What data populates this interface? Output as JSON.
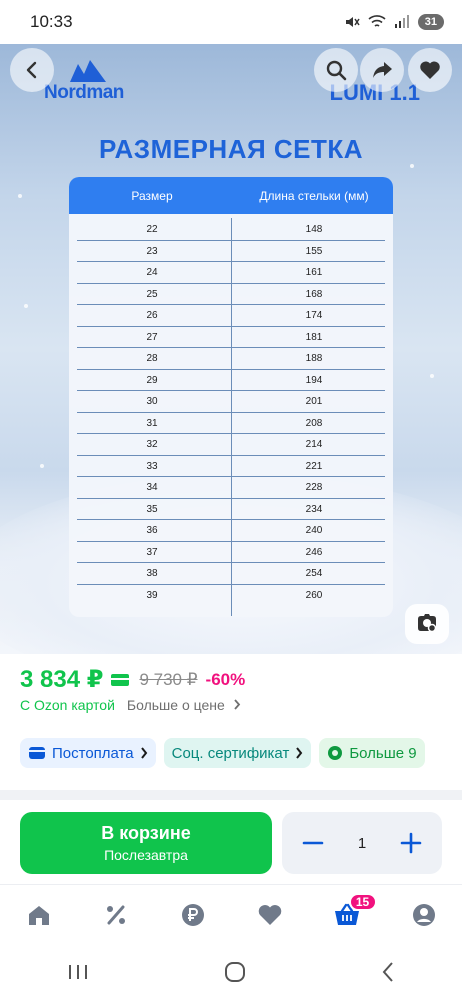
{
  "status_bar": {
    "time": "10:33",
    "battery": "31"
  },
  "product_image": {
    "brand": "Nordman",
    "model": "LUMI 1.1",
    "chart_title": "РАЗМЕРНАЯ СЕТКА",
    "table": {
      "headers": [
        "Размер",
        "Длина стельки (мм)"
      ],
      "rows": [
        [
          "22",
          "148"
        ],
        [
          "23",
          "155"
        ],
        [
          "24",
          "161"
        ],
        [
          "25",
          "168"
        ],
        [
          "26",
          "174"
        ],
        [
          "27",
          "181"
        ],
        [
          "28",
          "188"
        ],
        [
          "29",
          "194"
        ],
        [
          "30",
          "201"
        ],
        [
          "31",
          "208"
        ],
        [
          "32",
          "214"
        ],
        [
          "33",
          "221"
        ],
        [
          "34",
          "228"
        ],
        [
          "35",
          "234"
        ],
        [
          "36",
          "240"
        ],
        [
          "37",
          "246"
        ],
        [
          "38",
          "254"
        ],
        [
          "39",
          "260"
        ]
      ]
    }
  },
  "price": {
    "current": "3 834 ₽",
    "old": "9 730 ₽",
    "discount": "-60%",
    "with_card": "С Ozon картой",
    "more_link": "Больше о цене"
  },
  "chips": [
    {
      "label": "Постоплата",
      "icon": "wallet-icon"
    },
    {
      "label": "Соц. сертификат",
      "icon": "chevron-right-icon"
    },
    {
      "label": "Больше 9",
      "icon": "coin-icon"
    }
  ],
  "purchase": {
    "cart_label": "В корзине",
    "delivery": "Послезавтра",
    "quantity": "1"
  },
  "bottom_nav": {
    "items": [
      "home-icon",
      "percent-icon",
      "ruble-icon",
      "favorites-icon",
      "cart-icon",
      "profile-icon"
    ],
    "cart_badge": "15"
  },
  "colors": {
    "ozon_green": "#10c44c",
    "ozon_blue": "#0a58d6",
    "discount_pink": "#f1117e",
    "table_header": "#2f7ef0"
  }
}
